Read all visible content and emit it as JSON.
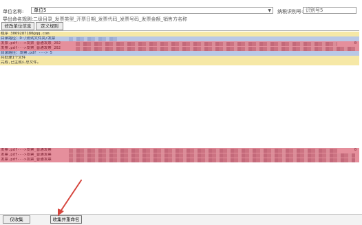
{
  "form": {
    "unit_name_label": "单位名称:",
    "unit_name_value": "单位5",
    "taxpayer_id_label": "纳税识别号:",
    "taxpayer_id_value": "识别号5",
    "naming_rule_label": "导出命名规则:",
    "naming_rule_value": "二级目录_发票类型_开票日期_发票代码_发票号码_发票金额_销售方名称"
  },
  "toolbar": {
    "modify_unit_button": "修改单位信息",
    "custom_rule_button": "定义规则"
  },
  "log": {
    "lines": [
      {
        "text": "程序  3069287180@qq.com",
        "style": "yellow",
        "end": ""
      },
      {
        "text": "目录路径：D:/测试文件夹/发票",
        "style": "blue",
        "end": ""
      },
      {
        "text": "发票.pdf--->发票_普通发票_202",
        "style": "red",
        "end": "0"
      },
      {
        "text": "发票.pdf--->发票_普通发票_202",
        "style": "red",
        "end": ""
      },
      {
        "text": "  目录路径：发票.pdf ---> 5",
        "style": "blue",
        "end": ""
      },
      {
        "text": "共处理1个文件",
        "style": "yellow",
        "end": ""
      },
      {
        "text": "完成,已生成汇总文件。",
        "style": "yellow",
        "end": ""
      },
      {
        "text": "发票.pdf--->发票_普通发票",
        "style": "red",
        "end": "0"
      },
      {
        "text": "发票.pdf--->发票_普通发票",
        "style": "red",
        "end": ""
      },
      {
        "text": "发票.pdf--->发票_普通发票",
        "style": "red",
        "end": ""
      }
    ]
  },
  "bottom": {
    "collect_button": "仅收集",
    "collect_rename_button": "收集并重命名"
  },
  "colors": {
    "annotation_arrow": "#d6453d"
  }
}
